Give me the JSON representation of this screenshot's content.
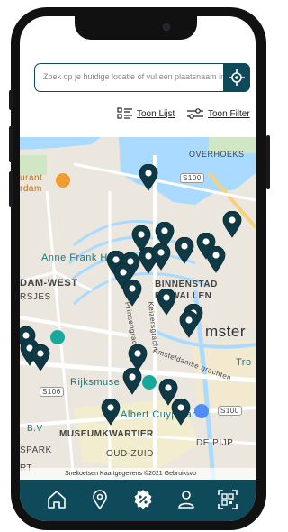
{
  "search": {
    "placeholder": "Zoek op je huidige locatie of vul een plaatsnaam in"
  },
  "toolbar": {
    "list_label": "Toon Lijst",
    "filter_label": "Toon Filter"
  },
  "map": {
    "labels": {
      "overhoeks": "OVERHOEKS",
      "restaurant": "urant",
      "restaurant2": "rdam",
      "s100a": "S100",
      "anne_frank": "Anne Frank H",
      "dam_west": "DAM-WEST",
      "binnenstad": "BINNENSTAD",
      "de_wallen": "DE WALLEN",
      "rsjes": "RSJES",
      "amster": "mster",
      "prinsengracht": "Prinsengracht",
      "keizersgracht": "Keizersgracht",
      "amstel": "Amsteldamse grachten",
      "tro": "Tro",
      "s106": "S106",
      "rijksmuseum": "Rijksmuse",
      "albert_cuyp": "Albert Cuypmar",
      "s100b": "S100",
      "bv": "B.V",
      "museumkwartier": "MUSEUMKWARTIER",
      "spark": "SPARK",
      "oud_zuid": "OUD-ZUID",
      "de_pijp": "DE PIJP",
      "rt": "RT"
    },
    "attribution": "Sneltoetsen   Kaartgegevens ©2021   Gebruiksvo"
  },
  "colors": {
    "brand": "#0f4a5a",
    "pin": "#0f3a45"
  },
  "nav": [
    "home-icon",
    "location-icon",
    "discount-icon",
    "user-icon",
    "qr-icon"
  ]
}
